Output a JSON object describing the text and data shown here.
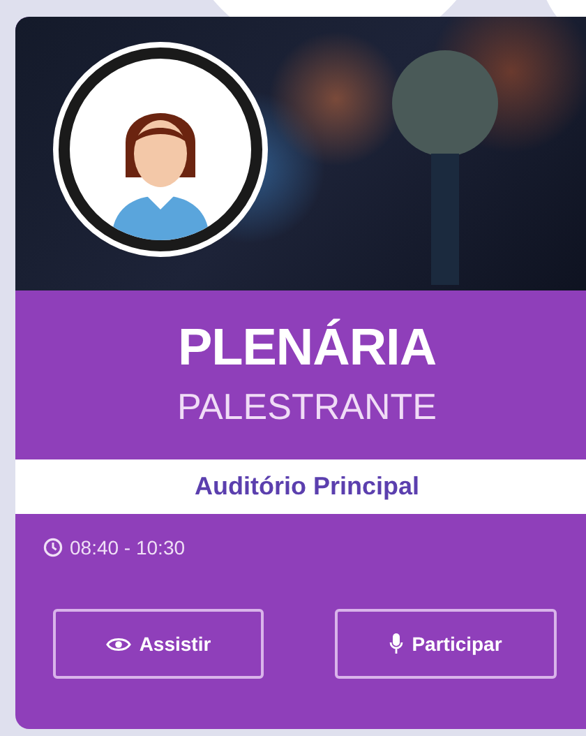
{
  "session": {
    "title": "PLENÁRIA",
    "role": "PALESTRANTE",
    "room": "Auditório Principal",
    "time": "08:40 - 10:30"
  },
  "buttons": [
    {
      "kind": "watch",
      "label": "Assistir"
    },
    {
      "kind": "speak",
      "label": "Participar"
    }
  ]
}
